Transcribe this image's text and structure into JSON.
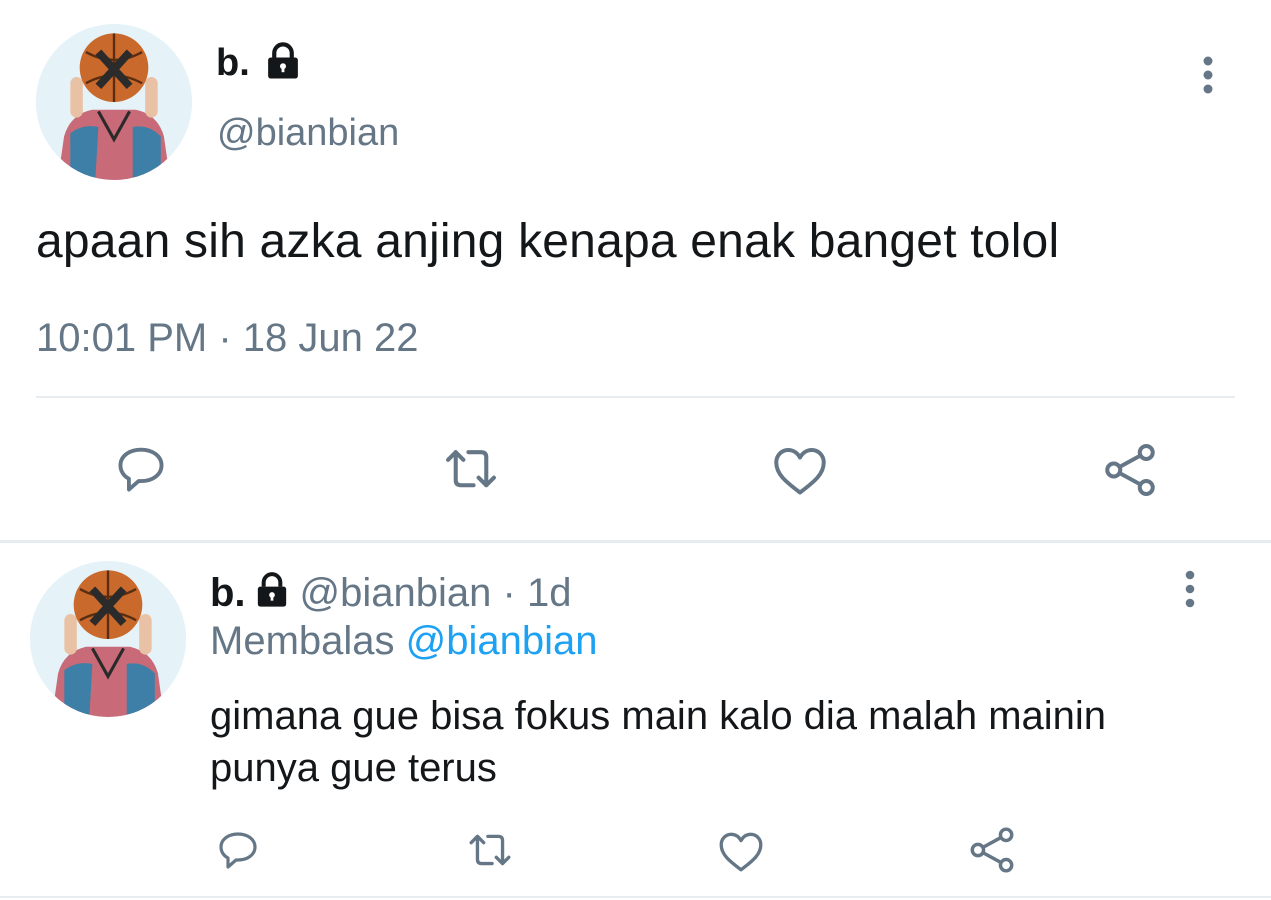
{
  "colors": {
    "text_primary": "#14171a",
    "text_secondary": "#657786",
    "link": "#1da1f2",
    "divider": "#e6ecf0"
  },
  "main_tweet": {
    "display_name": "b.",
    "handle": "@bianbian",
    "text": "apaan sih azka anjing kenapa enak banget tolol",
    "timestamp": "10:01 PM · 18 Jun 22",
    "icons": [
      "lock-icon",
      "more-icon",
      "reply-icon",
      "retweet-icon",
      "like-icon",
      "share-icon"
    ]
  },
  "reply_tweet": {
    "display_name": "b.",
    "handle": "@bianbian",
    "separator": "·",
    "age": "1d",
    "replying_label": "Membalas",
    "replying_handle": "@bianbian",
    "text": "gimana gue bisa fokus main kalo dia malah mainin punya gue terus",
    "icons": [
      "lock-icon",
      "more-icon",
      "reply-icon",
      "retweet-icon",
      "like-icon",
      "share-icon"
    ]
  }
}
